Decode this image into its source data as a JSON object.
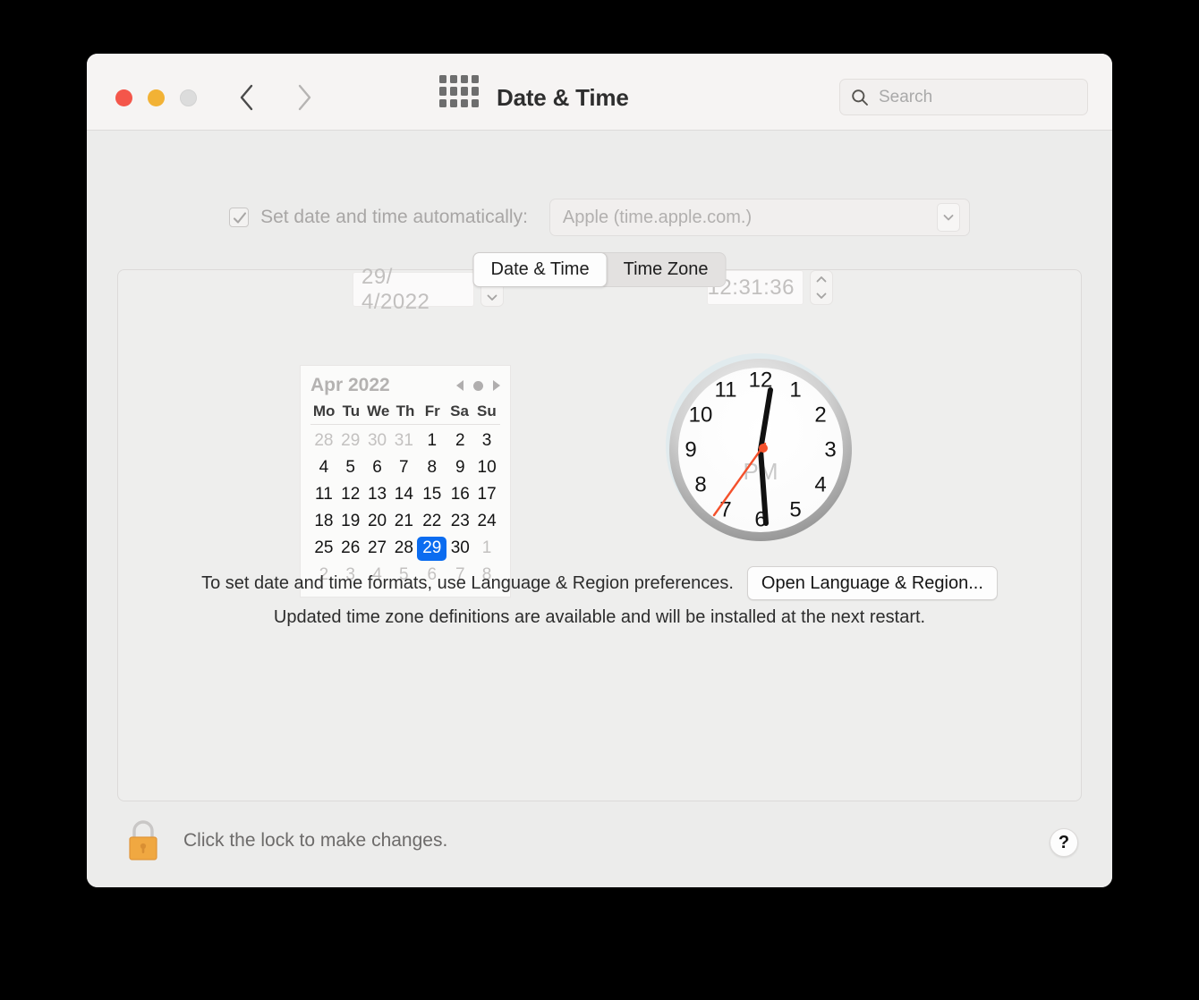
{
  "window": {
    "title": "Date & Time",
    "traffic_lights": [
      "close",
      "minimize",
      "zoom"
    ]
  },
  "toolbar": {
    "back_icon": "chevron-left-icon",
    "forward_icon": "chevron-right-icon",
    "grid_icon": "show-all-grid-icon",
    "search": {
      "icon": "search-icon",
      "placeholder": "Search",
      "value": ""
    }
  },
  "tabs": [
    {
      "label": "Date & Time",
      "active": true
    },
    {
      "label": "Time Zone",
      "active": false
    }
  ],
  "auto_set": {
    "checkbox_checked": true,
    "checkbox_enabled": false,
    "label": "Set date and time automatically:",
    "server_value": "Apple (time.apple.com.)",
    "dropdown_icon": "chevron-down-icon"
  },
  "date_field": {
    "value": "29/  4/2022",
    "stepper_icon": "stepper-up-down-icon"
  },
  "time_field": {
    "value": "12:31:36",
    "stepper_icon": "stepper-up-down-icon"
  },
  "calendar": {
    "month_label": "Apr 2022",
    "prev_icon": "triangle-left-icon",
    "today_icon": "dot-icon",
    "next_icon": "triangle-right-icon",
    "weekdays": [
      "Mo",
      "Tu",
      "We",
      "Th",
      "Fr",
      "Sa",
      "Su"
    ],
    "selected_day": 29,
    "weeks": [
      [
        {
          "n": "28",
          "muted": true
        },
        {
          "n": "29",
          "muted": true
        },
        {
          "n": "30",
          "muted": true
        },
        {
          "n": "31",
          "muted": true
        },
        {
          "n": "1",
          "muted": false
        },
        {
          "n": "2",
          "muted": false
        },
        {
          "n": "3",
          "muted": false
        }
      ],
      [
        {
          "n": "4",
          "muted": false
        },
        {
          "n": "5",
          "muted": false
        },
        {
          "n": "6",
          "muted": false
        },
        {
          "n": "7",
          "muted": false
        },
        {
          "n": "8",
          "muted": false
        },
        {
          "n": "9",
          "muted": false
        },
        {
          "n": "10",
          "muted": false
        }
      ],
      [
        {
          "n": "11",
          "muted": false
        },
        {
          "n": "12",
          "muted": false
        },
        {
          "n": "13",
          "muted": false
        },
        {
          "n": "14",
          "muted": false
        },
        {
          "n": "15",
          "muted": false
        },
        {
          "n": "16",
          "muted": false
        },
        {
          "n": "17",
          "muted": false
        }
      ],
      [
        {
          "n": "18",
          "muted": false
        },
        {
          "n": "19",
          "muted": false
        },
        {
          "n": "20",
          "muted": false
        },
        {
          "n": "21",
          "muted": false
        },
        {
          "n": "22",
          "muted": false
        },
        {
          "n": "23",
          "muted": false
        },
        {
          "n": "24",
          "muted": false
        }
      ],
      [
        {
          "n": "25",
          "muted": false
        },
        {
          "n": "26",
          "muted": false
        },
        {
          "n": "27",
          "muted": false
        },
        {
          "n": "28",
          "muted": false
        },
        {
          "n": "29",
          "muted": false,
          "selected": true
        },
        {
          "n": "30",
          "muted": false
        },
        {
          "n": "1",
          "muted": true
        }
      ],
      [
        {
          "n": "2",
          "muted": true
        },
        {
          "n": "3",
          "muted": true
        },
        {
          "n": "4",
          "muted": true
        },
        {
          "n": "5",
          "muted": true
        },
        {
          "n": "6",
          "muted": true
        },
        {
          "n": "7",
          "muted": true
        },
        {
          "n": "8",
          "muted": true
        }
      ]
    ]
  },
  "clock": {
    "meridiem": "PM",
    "numerals": [
      "1",
      "2",
      "3",
      "4",
      "5",
      "6",
      "7",
      "8",
      "9",
      "10",
      "11",
      "12"
    ],
    "hour": 12,
    "minute": 31,
    "second": 36,
    "hour_hand_angle": 8,
    "minute_hand_angle": 186,
    "second_hand_angle": 216,
    "second_hand_color": "#f4512c",
    "hand_color": "#111111"
  },
  "footer": {
    "format_text": "To set date and time formats, use Language & Region preferences.",
    "open_language_button": "Open Language & Region...",
    "timezone_note": "Updated time zone definitions are available and will be installed at the next restart."
  },
  "bottom_bar": {
    "lock_icon": "lock-closed-icon",
    "lock_text": "Click the lock to make changes.",
    "help_label": "?"
  },
  "colors": {
    "accent_blue": "#0b6cf0",
    "window_bg": "#ececeb",
    "toolbar_bg": "#f6f4f3",
    "second_hand": "#f4512c",
    "lock_body": "#f0a841"
  }
}
